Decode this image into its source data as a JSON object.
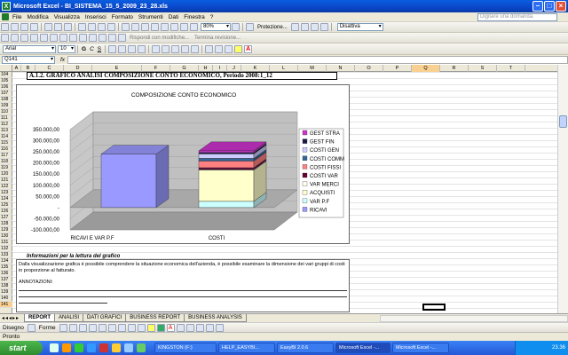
{
  "app": {
    "title": "Microsoft Excel - BI_SISTEMA_15_5_2009_23_28.xls"
  },
  "menu": {
    "items": [
      "File",
      "Modifica",
      "Visualizza",
      "Inserisci",
      "Formato",
      "Strumenti",
      "Dati",
      "Finestra",
      "?"
    ],
    "help_placeholder": "Digitare una domanda."
  },
  "toolbar": {
    "zoom": "80%",
    "protezione_label": "Protezione...",
    "disattiva_label": "Disattiva",
    "reply_label": "Rispondi con modifiche...",
    "end_review_label": "Termina revisione...",
    "font_name": "Arial",
    "font_size": "10",
    "bold": "G",
    "italic": "C",
    "underline": "S"
  },
  "formula_bar": {
    "name_box": "Q141",
    "fx": "fx"
  },
  "columns": [
    "A",
    "B",
    "C",
    "D",
    "E",
    "F",
    "G",
    "H",
    "I",
    "J",
    "K",
    "L",
    "M",
    "N",
    "O",
    "P",
    "Q",
    "R",
    "S",
    "T"
  ],
  "rows": [
    "104",
    "105",
    "106",
    "107",
    "108",
    "109",
    "110",
    "111",
    "112",
    "113",
    "114",
    "115",
    "116",
    "117",
    "118",
    "119",
    "120",
    "121",
    "122",
    "123",
    "124",
    "125",
    "126",
    "127",
    "128",
    "129",
    "130",
    "131",
    "132",
    "133",
    "134",
    "135",
    "136",
    "137",
    "138",
    "139",
    "140",
    "141"
  ],
  "sheet": {
    "heading": "A.1.2. GRAFICO ANALISI COMPOSIZIONE CONTO ECONOMICO, Periodo 2008:1_12",
    "info_title": "Informazioni per la lettura del grafico",
    "info_text": "Dalla visualizzazione grafica è possibile comprendere la situazione economica dell'azienda, è possibile esaminare la dimensione dei vari gruppi di costi in proporzione al fatturato.",
    "annotations_label": "ANNOTAZIONI:"
  },
  "chart_data": {
    "type": "bar",
    "title": "COMPOSIZIONE CONTO ECONOMICO",
    "categories": [
      "RICAVI E VAR P.F",
      "COSTI"
    ],
    "ylim": [
      -100000,
      350000
    ],
    "yticks": [
      "350.000,00",
      "300.000,00",
      "250.000,00",
      "200.000,00",
      "150.000,00",
      "100.000,00",
      "50.000,00",
      "-",
      "-50.000,00",
      "-100.000,00"
    ],
    "legend_position": "right",
    "series": [
      {
        "name": "GEST STRA",
        "color": "#cc33cc",
        "values": [
          0,
          8000
        ]
      },
      {
        "name": "GEST FIN",
        "color": "#1a1a4a",
        "values": [
          0,
          6000
        ]
      },
      {
        "name": "COSTI GEN",
        "color": "#ccccff",
        "values": [
          0,
          20000
        ]
      },
      {
        "name": "COSTI COMM",
        "color": "#336699",
        "values": [
          0,
          12000
        ]
      },
      {
        "name": "COSTI FISSI",
        "color": "#ff8080",
        "values": [
          0,
          30000
        ]
      },
      {
        "name": "COSTI VAR",
        "color": "#660033",
        "values": [
          0,
          8000
        ]
      },
      {
        "name": "VAR MERCI",
        "color": "#ffffee",
        "values": [
          0,
          3000
        ]
      },
      {
        "name": "ACQUISTI",
        "color": "#ffffcc",
        "values": [
          0,
          140000
        ]
      },
      {
        "name": "VAR P.F",
        "color": "#ccffff",
        "values": [
          0,
          28000
        ]
      },
      {
        "name": "RICAVI",
        "color": "#9999ff",
        "values": [
          240000,
          0
        ]
      }
    ]
  },
  "sheet_tabs": [
    "REPORT",
    "ANALISI",
    "DATI GRAFICI",
    "BUSINESS REPORT",
    "BUSINESS ANALYSIS"
  ],
  "active_tab": "REPORT",
  "drawing": {
    "draw_label": "Disegno",
    "shapes_label": "Forme"
  },
  "status": {
    "text": "Pronto"
  },
  "taskbar": {
    "start": "start",
    "tasks": [
      "KINGSTON (F:)",
      "HELP_EASYBI...",
      "EasyBI 2.0.6",
      "Microsoft Excel -...",
      "Microsoft Excel -..."
    ],
    "clock": "23.36"
  }
}
